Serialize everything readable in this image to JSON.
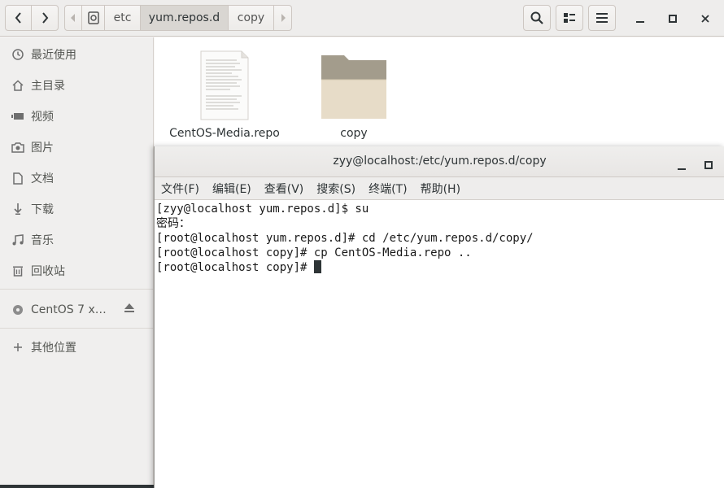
{
  "file_manager": {
    "path": [
      {
        "label": ""
      },
      {
        "label": "etc"
      },
      {
        "label": "yum.repos.d"
      },
      {
        "label": "copy"
      }
    ],
    "sidebar": {
      "items": [
        {
          "label": "最近使用",
          "icon": "clock-icon"
        },
        {
          "label": "主目录",
          "icon": "home-icon"
        },
        {
          "label": "视频",
          "icon": "video-icon"
        },
        {
          "label": "图片",
          "icon": "camera-icon"
        },
        {
          "label": "文档",
          "icon": "document-icon"
        },
        {
          "label": "下载",
          "icon": "download-icon"
        },
        {
          "label": "音乐",
          "icon": "music-icon"
        },
        {
          "label": "回收站",
          "icon": "trash-icon"
        }
      ],
      "devices": [
        {
          "label": "CentOS 7 x…",
          "icon": "disc-icon"
        }
      ],
      "other": {
        "label": "其他位置",
        "icon": "plus-icon"
      }
    },
    "files": [
      {
        "name": "CentOS-Media.repo",
        "icon": "text-file-icon"
      },
      {
        "name": "copy",
        "icon": "folder-icon"
      }
    ]
  },
  "terminal": {
    "title": "zyy@localhost:/etc/yum.repos.d/copy",
    "menu": [
      "文件(F)",
      "编辑(E)",
      "查看(V)",
      "搜索(S)",
      "终端(T)",
      "帮助(H)"
    ],
    "lines": [
      "[zyy@localhost yum.repos.d]$ su",
      "密码：",
      "[root@localhost yum.repos.d]# cd /etc/yum.repos.d/copy/",
      "[root@localhost copy]# cp CentOS-Media.repo ..",
      "[root@localhost copy]# "
    ]
  }
}
